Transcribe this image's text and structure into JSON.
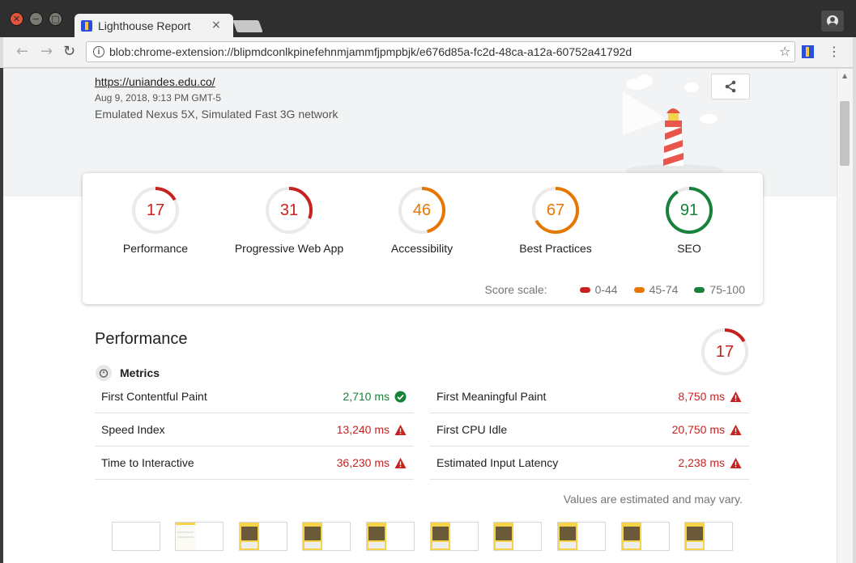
{
  "window": {
    "tab_title": "Lighthouse Report",
    "tab_close": "×"
  },
  "toolbar": {
    "url": "blob:chrome-extension://blipmdconlkpinefehnmjammfjpmpbjk/e676d85a-fc2d-48ca-a12a-60752a41792d"
  },
  "report": {
    "url": "https://uniandes.edu.co/",
    "date": "Aug 9, 2018, 9:13 PM GMT-5",
    "environment": "Emulated Nexus 5X, Simulated Fast 3G network"
  },
  "scores": [
    {
      "value": "17",
      "score": 17,
      "label": "Performance",
      "color": "#c7221f"
    },
    {
      "value": "31",
      "score": 31,
      "label": "Progressive Web App",
      "color": "#c7221f"
    },
    {
      "value": "46",
      "score": 46,
      "label": "Accessibility",
      "color": "#e67700"
    },
    {
      "value": "67",
      "score": 67,
      "label": "Best Practices",
      "color": "#e67700"
    },
    {
      "value": "91",
      "score": 91,
      "label": "SEO",
      "color": "#178239"
    }
  ],
  "score_scale": {
    "title": "Score scale:",
    "ranges": [
      {
        "label": "0-44",
        "color": "#c7221f"
      },
      {
        "label": "45-74",
        "color": "#e67700"
      },
      {
        "label": "75-100",
        "color": "#178239"
      }
    ]
  },
  "performance": {
    "title": "Performance",
    "score": "17",
    "score_value": 17,
    "metrics_label": "Metrics",
    "metrics": [
      {
        "name": "First Contentful Paint",
        "value": "2,710 ms",
        "status": "pass",
        "color": "#178239"
      },
      {
        "name": "First Meaningful Paint",
        "value": "8,750 ms",
        "status": "fail",
        "color": "#c7221f"
      },
      {
        "name": "Speed Index",
        "value": "13,240 ms",
        "status": "fail",
        "color": "#c7221f"
      },
      {
        "name": "First CPU Idle",
        "value": "20,750 ms",
        "status": "fail",
        "color": "#c7221f"
      },
      {
        "name": "Time to Interactive",
        "value": "36,230 ms",
        "status": "fail",
        "color": "#c7221f"
      },
      {
        "name": "Estimated Input Latency",
        "value": "2,238 ms",
        "status": "fail",
        "color": "#c7221f"
      }
    ],
    "note": "Values are estimated and may vary."
  }
}
